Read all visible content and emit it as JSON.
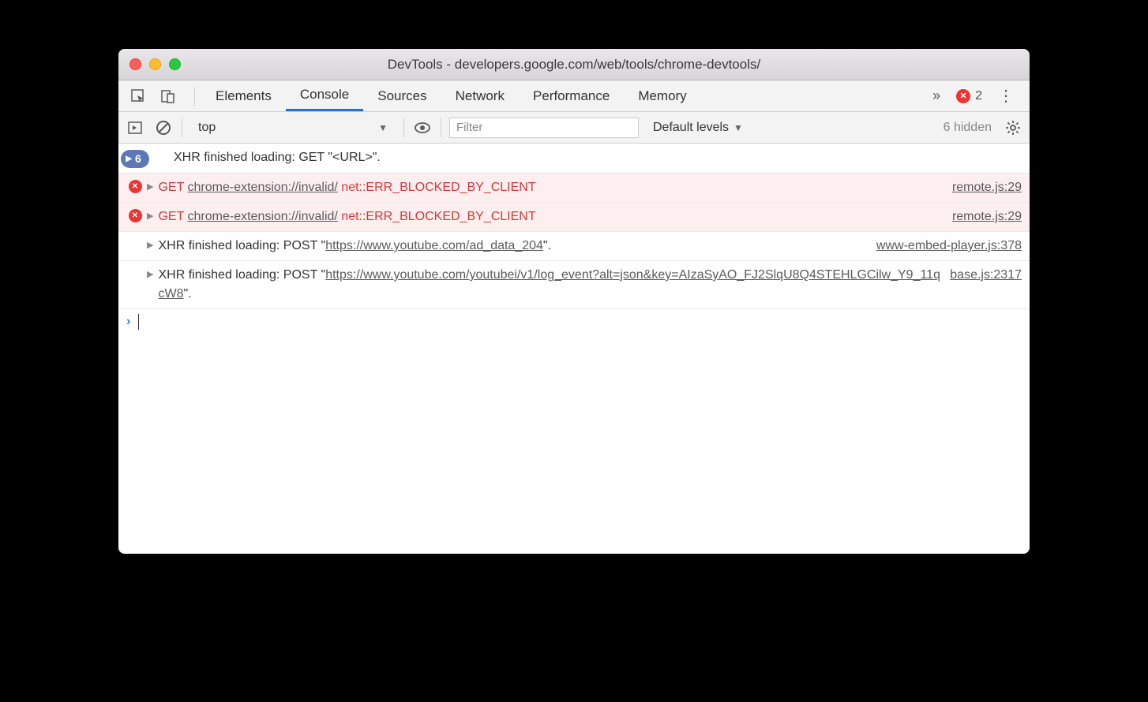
{
  "window": {
    "title": "DevTools - developers.google.com/web/tools/chrome-devtools/"
  },
  "tabs": {
    "items": [
      {
        "label": "Elements",
        "active": false
      },
      {
        "label": "Console",
        "active": true
      },
      {
        "label": "Sources",
        "active": false
      },
      {
        "label": "Network",
        "active": false
      },
      {
        "label": "Performance",
        "active": false
      },
      {
        "label": "Memory",
        "active": false
      }
    ],
    "more_icon": "»",
    "error_count": "2"
  },
  "toolbar": {
    "context": "top",
    "filter_placeholder": "Filter",
    "levels": "Default levels",
    "hidden": "6 hidden"
  },
  "logs": [
    {
      "type": "info-group",
      "badge_count": "6",
      "text": "XHR finished loading: GET \"<URL>\"."
    },
    {
      "type": "error",
      "method": "GET",
      "url": "chrome-extension://invalid/",
      "err": "net::ERR_BLOCKED_BY_CLIENT",
      "source": "remote.js:29"
    },
    {
      "type": "error",
      "method": "GET",
      "url": "chrome-extension://invalid/",
      "err": "net::ERR_BLOCKED_BY_CLIENT",
      "source": "remote.js:29"
    },
    {
      "type": "info",
      "prefix": "XHR finished loading: POST \"",
      "url": "https://www.youtube.com/ad_data_204",
      "suffix": "\".",
      "source": "www-embed-player.js:378"
    },
    {
      "type": "info",
      "prefix": "XHR finished loading: POST \"",
      "url": "https://www.youtube.com/youtubei/v1/log_event?alt=json&key=AIzaSyAO_FJ2SlqU8Q4STEHLGCilw_Y9_11qcW8",
      "suffix": "\".",
      "source": "base.js:2317"
    }
  ]
}
